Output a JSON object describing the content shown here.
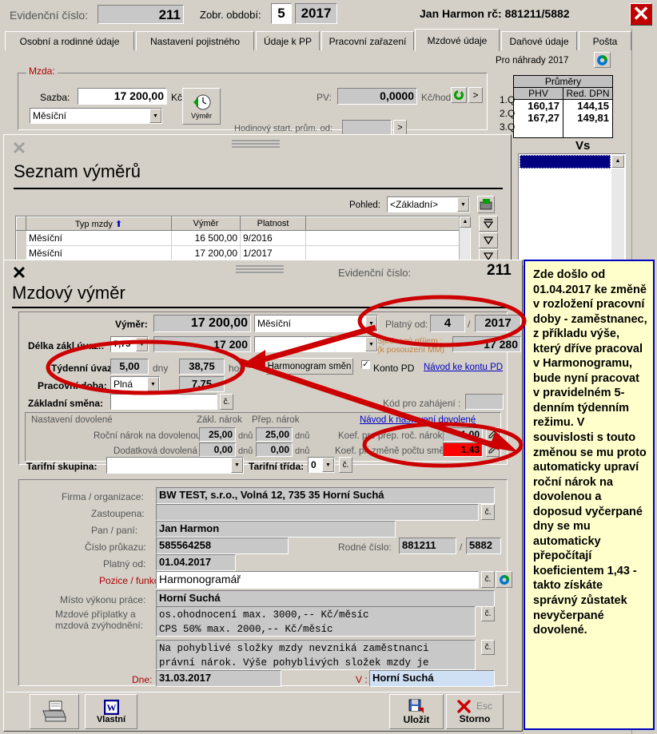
{
  "header": {
    "evidence_label": "Evidenční číslo:",
    "evidence_value": "211",
    "period_label": "Zobr. období:",
    "period_month": "5",
    "period_year": "2017",
    "person": "Jan Harmon rč: 881211/5882",
    "close_icon": "close-icon"
  },
  "tabs": [
    {
      "label": "Osobní a rodinné údaje",
      "active": false
    },
    {
      "label": "Nastavení pojistného",
      "active": false
    },
    {
      "label": "Údaje k PP",
      "active": false
    },
    {
      "label": "Pracovní zařazení",
      "active": false
    },
    {
      "label": "Mzdové údaje",
      "active": true
    },
    {
      "label": "Daňové údaje",
      "active": false
    },
    {
      "label": "Pošta",
      "active": false
    }
  ],
  "wage": {
    "group_caption": "Mzda:",
    "rate_label": "Sazba:",
    "rate_value": "17 200,00",
    "rate_unit": "Kč",
    "type_value": "Měsíční",
    "pv_label": "PV:",
    "pv_value": "0,0000",
    "pv_unit": "Kč/hod",
    "vymer_button": "Výměr",
    "hourly_start_label": "Hodinový start. prům. od:",
    "hourly_start_value": ""
  },
  "averages": {
    "title": "Pro náhrady 2017",
    "refresh_icon": "refresh-icon",
    "table_title": "Průměry",
    "columns": [
      "PHV",
      "Red. DPN"
    ],
    "rows": [
      {
        "q": "1.Q",
        "phv": "160,17",
        "dpn": "144,15"
      },
      {
        "q": "2.Q",
        "phv": "167,27",
        "dpn": "149,81"
      },
      {
        "q": "3.Q",
        "phv": "",
        "dpn": ""
      }
    ],
    "vs_label": "Vs"
  },
  "seznam_window": {
    "title": "Seznam výměrů",
    "close_icon": "close-icon",
    "view_label": "Pohled:",
    "view_value": "<Základní>",
    "export_icon": "export-icon",
    "columns": [
      "Typ mzdy",
      "Výměr",
      "Platnost",
      ""
    ],
    "sort_icon": "sort-asc-icon",
    "rows": [
      {
        "typ": "Měsíční",
        "vymer": "16 500,00",
        "platnost": "9/2016",
        "note": ""
      },
      {
        "typ": "Měsíční",
        "vymer": "17 200,00",
        "platnost": "1/2017",
        "note": ""
      }
    ],
    "nav_icons": [
      "first-record-icon",
      "prev-record-icon",
      "next-record-icon"
    ]
  },
  "vymer_window": {
    "title": "Mzdový výměr",
    "close_icon": "close-icon",
    "evidence_label": "Evidenční číslo:",
    "evidence_value": "211",
    "vymer_label": "Výměr:",
    "vymer_value": "17 200,00",
    "vymer_type": "Měsíční",
    "valid_from_label": "Platný od:",
    "valid_from_month": "4",
    "valid_from_sep": "/",
    "valid_from_year": "2017",
    "delka_label": "Délka zákl.úvaz.:",
    "delka_value": "7,75",
    "delka_amount": "17 200",
    "delka_combo": "",
    "sjednany_label_1": "Sjednaný příjem :",
    "sjednany_label_2": "(k posouzení MM)",
    "sjednany_value": "17 280",
    "tydenni_label": "Týdenní úvaz.:",
    "tydenni_days": "5,00",
    "tydenni_days_unit": "dny",
    "tydenni_hours": "38,75",
    "tydenni_hours_unit": "hod",
    "harmonogram_checkbox": false,
    "harmonogram_button": "Harmonogram směn",
    "konto_pd_checked": true,
    "konto_pd_label": "Konto PD",
    "konto_pd_link": "Návod ke kontu PD",
    "pracovni_doba_label": "Pracovní doba:",
    "pracovni_doba_value": "Plná",
    "pracovni_doba_hours": "7,75",
    "zakladni_smena_label": "Základní směna:",
    "zakladni_smena_value": "",
    "kod_label": "Kód pro zahájení :",
    "kod_value": "",
    "dovolena": {
      "caption": "Nastavení dovolené",
      "col1": "Zákl. nárok",
      "col2": "Přep. nárok",
      "link": "Návod k nastavení dovolené",
      "row1_label": "Roční nárok na dovolenou :",
      "row1_v1": "25,00",
      "row1_u1": "dnů",
      "row1_v2": "25,00",
      "row1_u2": "dnů",
      "row2_label": "Dodatková dovolená :",
      "row2_v1": "0,00",
      "row2_u1": "dnů",
      "row2_v2": "0,00",
      "row2_u2": "dnů",
      "koef1_label": "Koef. pro přep. roč. nároku :",
      "koef1_value": "1,00",
      "koef2_label": "Koef. při změně počtu směn :",
      "koef2_value": "1,43",
      "koef2_color": "#ff0000"
    },
    "tarif_skupina_label": "Tarifní skupina:",
    "tarif_skupina_value": "",
    "tarif_trida_label": "Tarifní třída:",
    "tarif_trida_value": "0",
    "firma_label": "Firma / organizace:",
    "firma_value": "BW TEST, s.r.o., Volná 12, 735 35   Horní Suchá",
    "zastoupena_label": "Zastoupena:",
    "zastoupena_value": "",
    "pan_label": "Pan / paní:",
    "pan_value": "Jan  Harmon",
    "prukaz_label": "Číslo průkazu:",
    "prukaz_value": "585564258",
    "rodne_label": "Rodné číslo:",
    "rodne_value1": "881211",
    "rodne_sep": "/",
    "rodne_value2": "5882",
    "platny_od_label": "Platný od:",
    "platny_od_value": "01.04.2017",
    "pozice_label": "Pozice / funkce:",
    "pozice_value": "Harmonogramář",
    "misto_label": "Místo výkonu práce:",
    "misto_value": "Horní Suchá",
    "priplatky_label_1": "Mzdové příplatky a",
    "priplatky_label_2": "mzdová zvýhodnění:",
    "priplatky_line1": "os.ohodnocení          max. 3000,-- Kč/měsíc",
    "priplatky_line2": "CPS 50%                max. 2000,-- Kč/měsíc",
    "poznamka_line1": "Na pohyblivé složky mzdy nevzniká zaměstnanci",
    "poznamka_line2": "právní nárok. Výše pohyblivých složek mzdy je",
    "dne_label": "Dne:",
    "dne_value": "31.03.2017",
    "v_label": "V :",
    "v_value": "Horní Suchá",
    "print_button_icon": "printer-icon",
    "vlastni_button": "Vlastní",
    "vlastni_icon": "word-icon",
    "save_button": "Uložit",
    "save_icon": "save-icon",
    "cancel_button": "Storno",
    "cancel_hint": "Esc",
    "cancel_icon": "cancel-x-icon"
  },
  "annotation": {
    "text": "Zde došlo od 01.04.2017 ke změně v rozložení pracovní doby - zaměstnanec, z příkladu výše, který dříve pracoval v Harmonogramu, bude nyní pracovat v pravidelném 5-denním týdenním režimu. V souvislosti s touto změnou se mu proto automaticky upraví roční nárok na dovolenou a doposud vyčerpané dny se mu automaticky přepočítají koeficientem 1,43 - takto získáte správný zůstatek nevyčerpané dovolené.",
    "border_color": "#0000c0",
    "background": "#ffffcc"
  },
  "highlight_color": "#cc0000"
}
